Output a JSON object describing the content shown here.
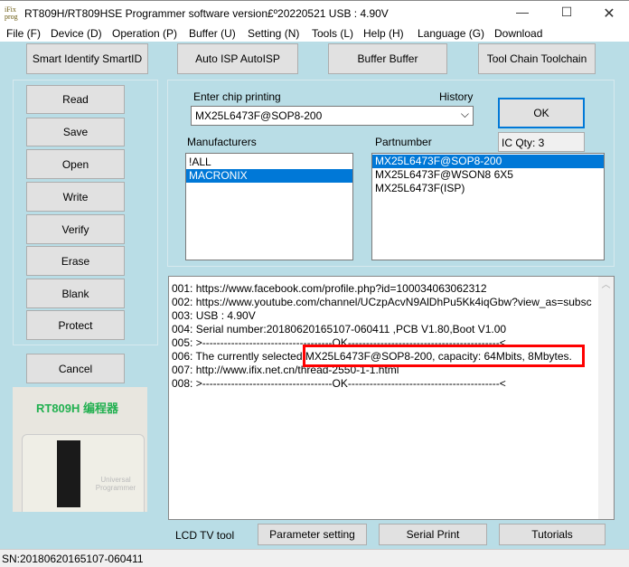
{
  "title": "RT809H/RT809HSE Programmer software version£º20220521  USB : 4.90V",
  "logo_text": "iFix prog",
  "menu": [
    "File (F)",
    "Device (D)",
    "Operation (P)",
    "Buffer (U)",
    "Setting (N)",
    "Tools (L)",
    "Help (H)",
    "Language (G)",
    "Download"
  ],
  "top_buttons": [
    "Smart Identify SmartID",
    "Auto ISP AutoISP",
    "Buffer Buffer",
    "Tool Chain Toolchain"
  ],
  "left_buttons": [
    "Read",
    "Save",
    "Open",
    "Write",
    "Verify",
    "Erase",
    "Blank",
    "Protect"
  ],
  "cancel": "Cancel",
  "product_image": {
    "caption": "RT809H 编程器",
    "device_text": "Universal Programmer"
  },
  "chip": {
    "label": "Enter chip printing",
    "history": "History",
    "value": "MX25L6473F@SOP8-200",
    "ok": "OK",
    "ic_qty": "IC Qty: 3"
  },
  "manufacturers": {
    "label": "Manufacturers",
    "items": [
      "!ALL",
      "MACRONIX"
    ],
    "selected": 1
  },
  "partnumber": {
    "label": "Partnumber",
    "items": [
      "MX25L6473F@SOP8-200",
      "MX25L6473F@WSON8 6X5",
      "MX25L6473F(ISP)"
    ],
    "selected": 0
  },
  "log": [
    "001:  https://www.facebook.com/profile.php?id=100034063062312",
    "002:  https://www.youtube.com/channel/UCzpAcvN9AlDhPu5Kk4iqGbw?view_as=subsc",
    "003:  USB : 4.90V",
    "004:  Serial number:20180620165107-060411  ,PCB V1.80,Boot V1.00",
    "005:  >------------------------------------OK------------------------------------------<",
    "006:  The currently selected:MX25L6473F@SOP8-200, capacity: 64Mbits, 8Mbytes.",
    "007:  http://www.ifix.net.cn/thread-2550-1-1.html",
    "008:  >------------------------------------OK------------------------------------------<"
  ],
  "bottom": {
    "lcd": "LCD TV tool",
    "tabs": [
      "Parameter setting",
      "Serial Print",
      "Tutorials"
    ]
  },
  "status": "SN:20180620165107-060411",
  "colors": {
    "background": "#b9dde6",
    "highlight": "#ff0000",
    "selection": "#0078d7"
  }
}
